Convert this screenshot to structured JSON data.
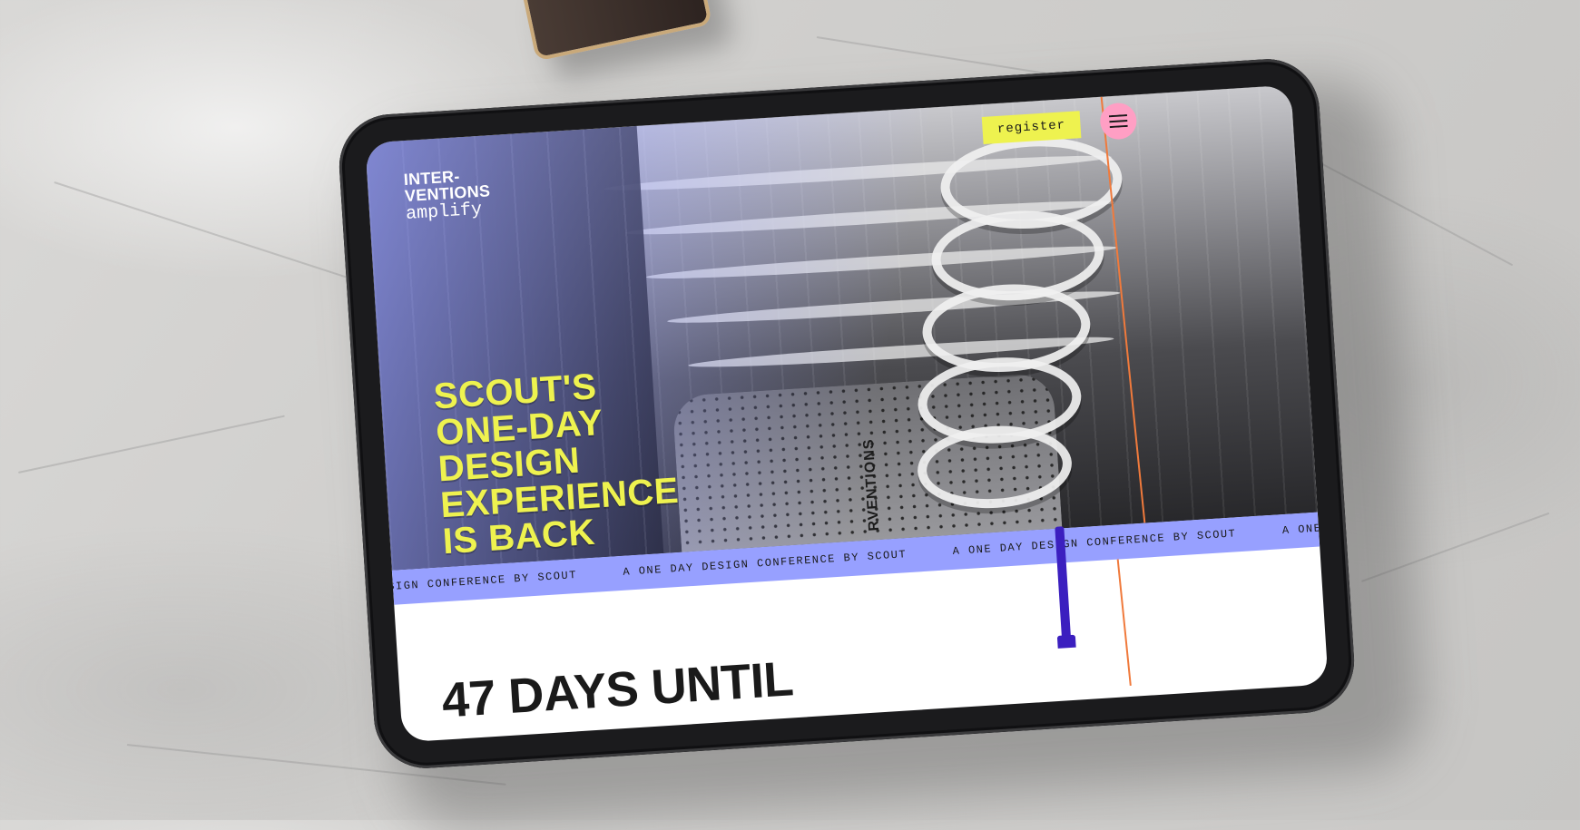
{
  "site": {
    "logo": {
      "line1": "INTER-",
      "line2": "VENTIONS",
      "subline": "amplify"
    },
    "header": {
      "register_label": "register",
      "menu_icon": "hamburger-icon"
    },
    "hero": {
      "headline": [
        "SCOUT'S",
        "ONE-DAY",
        "DESIGN",
        "EXPERIENCE",
        "IS BACK"
      ],
      "vertical_sign": "RVENTIONS"
    },
    "ticker": {
      "items": [
        "A ONE DAY DESIGN CONFERENCE BY SCOUT",
        "A ONE DAY DESIGN CONFERENCE BY SCOUT",
        "A ONE DAY DESIGN CONFERENCE BY SCOUT",
        "A ONE DAY DESIGN"
      ]
    },
    "countdown": {
      "text": "47 DAYS UNTIL"
    }
  },
  "colors": {
    "accent_yellow": "#eef24f",
    "ticker_lavender": "#97a0ff",
    "menu_pink": "#ff9fc4",
    "guide_orange": "#f07a3c",
    "pole_indigo": "#3b1fbf"
  }
}
